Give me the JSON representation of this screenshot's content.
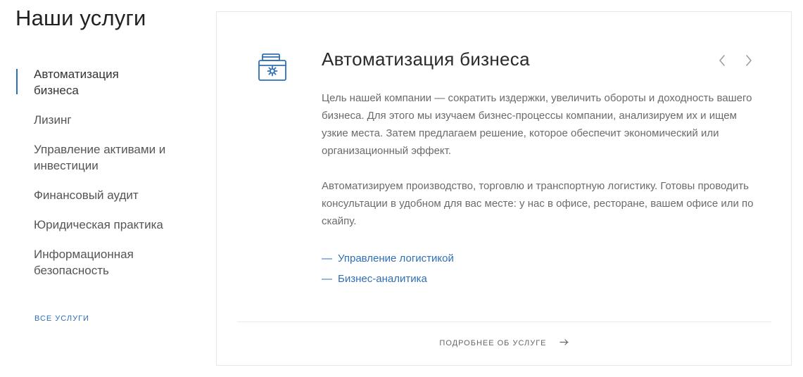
{
  "page": {
    "title": "Наши услуги"
  },
  "sidebar": {
    "items": [
      {
        "label": "Автоматизация бизнеса",
        "active": true
      },
      {
        "label": "Лизинг",
        "active": false
      },
      {
        "label": "Управление активами и инвестиции",
        "active": false
      },
      {
        "label": "Финансовый аудит",
        "active": false
      },
      {
        "label": "Юридическая практика",
        "active": false
      },
      {
        "label": "Информационная безопасность",
        "active": false
      }
    ],
    "all_services_label": "ВСЕ УСЛУГИ"
  },
  "service_card": {
    "icon": "briefcase-gear-icon",
    "title": "Автоматизация бизнеса",
    "paragraphs": [
      "Цель нашей компании — сократить издержки, увеличить обороты и доходность вашего бизнеса. Для этого мы изучаем бизнес-процессы компании, анализируем их и ищем узкие места. Затем предлагаем решение, которое обеспечит экономический или организационный эффект.",
      "Автоматизируем производство, торговлю и транспортную логистику. Готовы проводить консультации в удобном для вас месте: у нас в офисе, ресторане, вашем офисе или по скайпу."
    ],
    "links": [
      {
        "dash": "—",
        "label": "Управление логистикой"
      },
      {
        "dash": "—",
        "label": "Бизнес-аналитика"
      }
    ],
    "more_label": "ПОДРОБНЕЕ ОБ УСЛУГЕ"
  },
  "colors": {
    "accent": "#2f6fb8",
    "text_dark": "#222222",
    "text_muted": "#6b6b6b",
    "border": "#e7e7e7"
  }
}
